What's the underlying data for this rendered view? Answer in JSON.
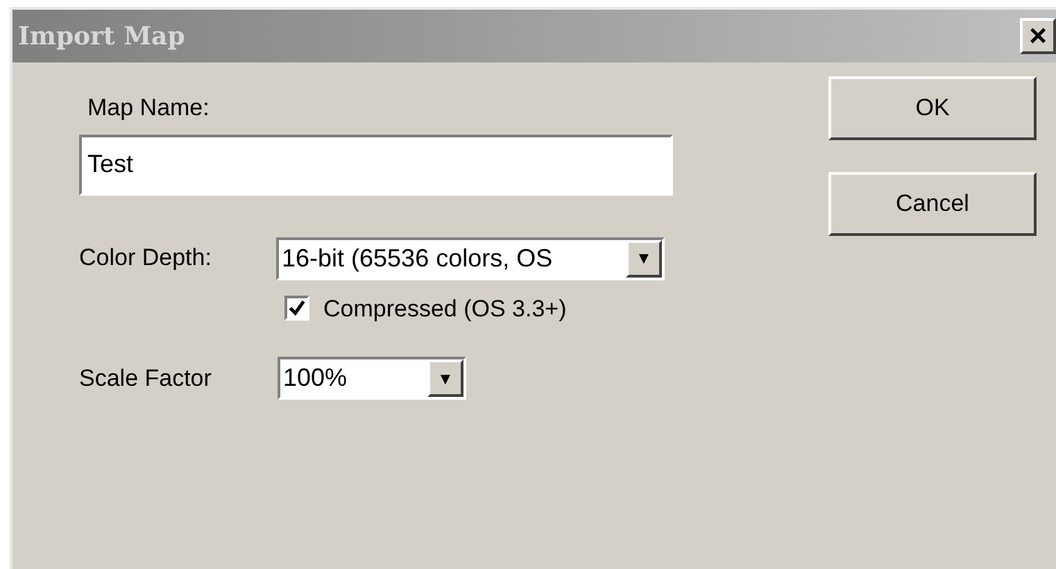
{
  "window": {
    "title": "Import Map",
    "close": "×"
  },
  "map_name": {
    "label": "Map Name:",
    "value": "Test"
  },
  "color_depth": {
    "label": "Color Depth:",
    "value": "16-bit (65536 colors, OS",
    "arrow": "▼"
  },
  "compressed": {
    "label": "Compressed (OS 3.3+)",
    "checked": true
  },
  "scale_factor": {
    "label": "Scale Factor",
    "value": "100%",
    "arrow": "▼"
  },
  "buttons": [
    "OK",
    "Cancel"
  ]
}
